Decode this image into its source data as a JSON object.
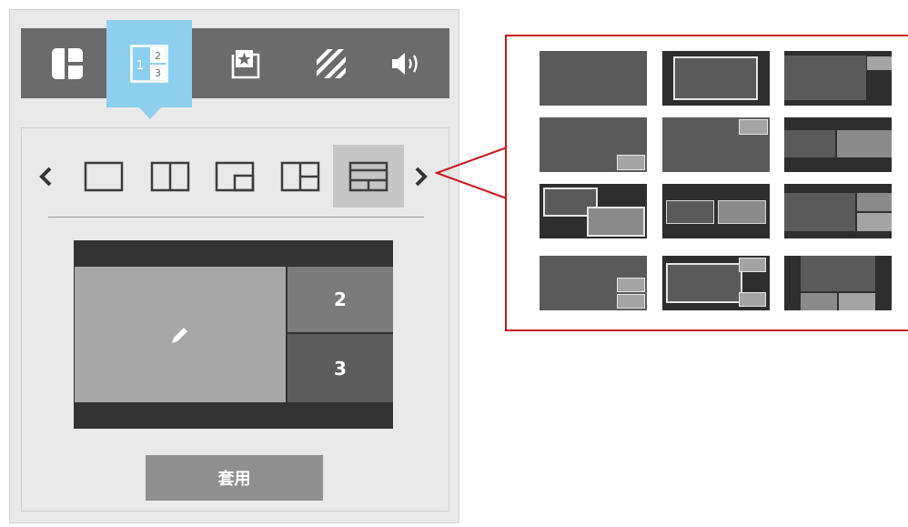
{
  "toolbar": {
    "tabs": [
      {
        "name": "layout-grid",
        "icon": "layout-grid-icon"
      },
      {
        "name": "split-screen",
        "icon": "split-screen-icon",
        "selected": true
      },
      {
        "name": "sticker",
        "icon": "sticker-star-icon"
      },
      {
        "name": "background",
        "icon": "stripes-icon"
      },
      {
        "name": "audio",
        "icon": "speaker-icon"
      }
    ]
  },
  "layout_picker": {
    "prev_icon": "chevron-left-icon",
    "next_icon": "chevron-right-icon",
    "selected_index": 4
  },
  "preview": {
    "cell2_label": "2",
    "cell3_label": "3",
    "edit_icon": "pencil-icon"
  },
  "apply_label": "套用",
  "colors": {
    "accent": "#8fcfee",
    "callout_border": "#c9161d",
    "toolbar_bg": "#6b6b6b",
    "panel_bg": "#e9e9e9"
  }
}
